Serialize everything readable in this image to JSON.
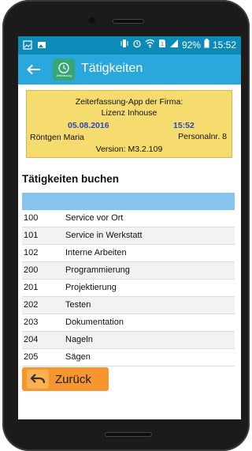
{
  "statusbar": {
    "battery": "92%",
    "time": "15:52"
  },
  "appbar": {
    "title": "Tätigkeiten",
    "logo_text": "Zeiterfassung"
  },
  "info": {
    "company_line": "Zeiterfassung-App der Firma:",
    "license_line": "Lizenz Inhouse",
    "date": "05.08.2016",
    "time": "15:52",
    "name": "Röntgen Maria",
    "personal_nr": "Personalnr. 8",
    "version": "Version: M3.2.109"
  },
  "section_title": "Tätigkeiten buchen",
  "activities": [
    {
      "code": "100",
      "desc": "Service vor Ort"
    },
    {
      "code": "101",
      "desc": "Service in Werkstatt"
    },
    {
      "code": "102",
      "desc": "Interne Arbeiten"
    },
    {
      "code": "200",
      "desc": "Programmierung"
    },
    {
      "code": "201",
      "desc": "Projektierung"
    },
    {
      "code": "202",
      "desc": "Testen"
    },
    {
      "code": "203",
      "desc": "Dokumentation"
    },
    {
      "code": "204",
      "desc": "Nageln"
    },
    {
      "code": "205",
      "desc": "Sägen"
    }
  ],
  "back_button": {
    "label": "Zurück"
  },
  "colors": {
    "statusbar": "#0c8ab8",
    "appbar": "#2aa7dc",
    "info_box": "#f6db6e",
    "table_header": "#88c4ee",
    "back_button": "#f7962f"
  }
}
